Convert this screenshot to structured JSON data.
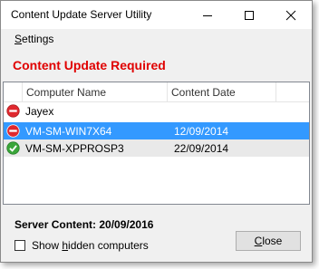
{
  "window": {
    "title": "Content Update Server Utility"
  },
  "menu": {
    "settings_label": "Settings",
    "settings_mnemonic": "S",
    "settings_rest": "ettings"
  },
  "status": {
    "text": "Content Update Required",
    "color": "#e00000"
  },
  "list": {
    "columns": [
      "Computer Name",
      "Content Date"
    ],
    "rows": [
      {
        "name": "Jayex",
        "date": "",
        "status_icon": "error-icon",
        "selected": false
      },
      {
        "name": "VM-SM-WIN7X64",
        "date": "12/09/2014",
        "status_icon": "error-icon",
        "selected": true
      },
      {
        "name": "VM-SM-XPPROSP3",
        "date": "22/09/2014",
        "status_icon": "ok-check-icon",
        "selected": false
      }
    ]
  },
  "footer": {
    "server_content": "Server Content: 20/09/2016",
    "show_hidden_pre": "Show ",
    "show_hidden_mnemonic": "h",
    "show_hidden_post": "idden computers",
    "show_hidden_label": "Show hidden computers",
    "show_hidden_checked": false,
    "close_mnemonic": "C",
    "close_rest": "lose",
    "close_label": "Close"
  },
  "colors": {
    "selection": "#3399ff",
    "error": "#e0282e",
    "ok": "#3aa63a"
  }
}
